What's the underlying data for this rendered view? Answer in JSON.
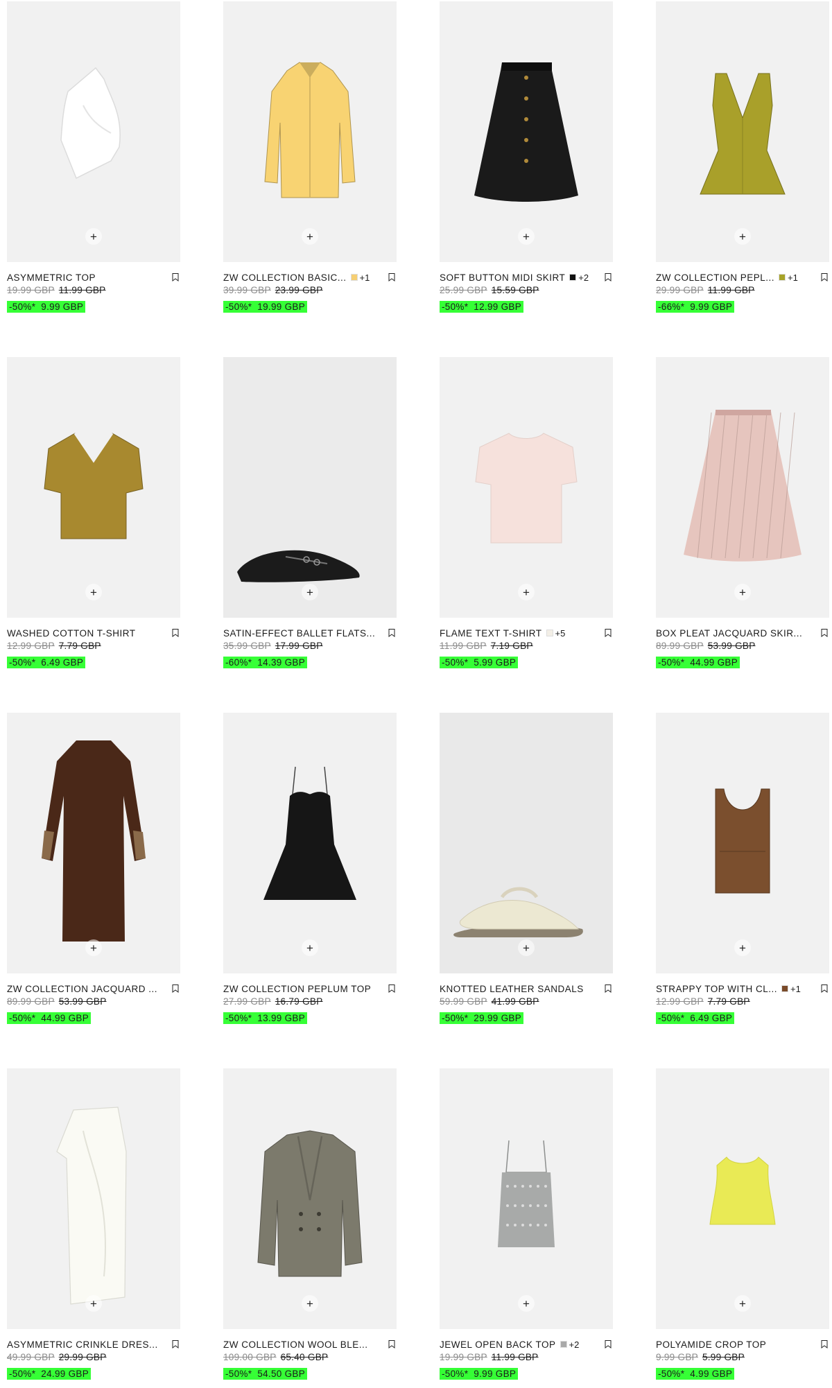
{
  "products": [
    {
      "name": "ASYMMETRIC TOP",
      "swatches": [],
      "more": "",
      "original": "19.99 GBP",
      "previous": "11.99 GBP",
      "discount": "-50%*",
      "price": "9.99 GBP",
      "bg": "#f1f1f1",
      "garment": "asym-top",
      "color": "#ffffff"
    },
    {
      "name": "ZW COLLECTION BASIC...",
      "swatches": [
        "#f6cf73"
      ],
      "more": "+1",
      "original": "39.99 GBP",
      "previous": "23.99 GBP",
      "discount": "-50%*",
      "price": "19.99 GBP",
      "bg": "#f1f1f1",
      "garment": "shirt",
      "color": "#f8d372"
    },
    {
      "name": "SOFT BUTTON MIDI SKIRT",
      "swatches": [
        "#111111"
      ],
      "more": "+2",
      "original": "25.99 GBP",
      "previous": "15.59 GBP",
      "discount": "-50%*",
      "price": "12.99 GBP",
      "bg": "#f1f1f1",
      "garment": "midi-skirt",
      "color": "#1a1a1a"
    },
    {
      "name": "ZW COLLECTION PEPL...",
      "swatches": [
        "#a7a328"
      ],
      "more": "+1",
      "original": "29.99 GBP",
      "previous": "11.99 GBP",
      "discount": "-66%*",
      "price": "9.99 GBP",
      "bg": "#f1f1f1",
      "garment": "peplum-vtop",
      "color": "#a9a02a"
    },
    {
      "name": "WASHED COTTON T-SHIRT",
      "swatches": [],
      "more": "",
      "original": "12.99 GBP",
      "previous": "7.79 GBP",
      "discount": "-50%*",
      "price": "6.49 GBP",
      "bg": "#f1f1f1",
      "garment": "vtee",
      "color": "#a8892f"
    },
    {
      "name": "SATIN-EFFECT BALLET FLATS...",
      "swatches": [],
      "more": "",
      "original": "35.99 GBP",
      "previous": "17.99 GBP",
      "discount": "-60%*",
      "price": "14.39 GBP",
      "bg": "#ebebeb",
      "garment": "flat",
      "color": "#1b1b1b"
    },
    {
      "name": "FLAME TEXT T-SHIRT",
      "swatches": [
        "#f3efe7"
      ],
      "more": "+5",
      "original": "11.99 GBP",
      "previous": "7.19 GBP",
      "discount": "-50%*",
      "price": "5.99 GBP",
      "bg": "#f1f1f1",
      "garment": "tee",
      "color": "#f6e1dc"
    },
    {
      "name": "BOX PLEAT JACQUARD SKIR...",
      "swatches": [],
      "more": "",
      "original": "89.99 GBP",
      "previous": "53.99 GBP",
      "discount": "-50%*",
      "price": "44.99 GBP",
      "bg": "#f1f1f1",
      "garment": "pleat-skirt",
      "color": "#e6c5be"
    },
    {
      "name": "ZW COLLECTION JACQUARD ...",
      "swatches": [],
      "more": "",
      "original": "89.99 GBP",
      "previous": "53.99 GBP",
      "discount": "-50%*",
      "price": "44.99 GBP",
      "bg": "#f1f1f1",
      "garment": "long-dress",
      "color": "#4a2818"
    },
    {
      "name": "ZW COLLECTION PEPLUM TOP",
      "swatches": [],
      "more": "",
      "original": "27.99 GBP",
      "previous": "16.79 GBP",
      "discount": "-50%*",
      "price": "13.99 GBP",
      "bg": "#f1f1f1",
      "garment": "cami-peplum",
      "color": "#161616"
    },
    {
      "name": "KNOTTED LEATHER SANDALS",
      "swatches": [],
      "more": "",
      "original": "59.99 GBP",
      "previous": "41.99 GBP",
      "discount": "-50%*",
      "price": "29.99 GBP",
      "bg": "#e9e9e9",
      "garment": "sandal",
      "color": "#ece8d2"
    },
    {
      "name": "STRAPPY TOP WITH CL...",
      "swatches": [
        "#7a4b2a"
      ],
      "more": "+1",
      "original": "12.99 GBP",
      "previous": "7.79 GBP",
      "discount": "-50%*",
      "price": "6.49 GBP",
      "bg": "#f1f1f1",
      "garment": "tank",
      "color": "#7b4f2e"
    },
    {
      "name": "ASYMMETRIC CRINKLE DRES...",
      "swatches": [],
      "more": "",
      "original": "49.99 GBP",
      "previous": "29.99 GBP",
      "discount": "-50%*",
      "price": "24.99 GBP",
      "bg": "#f1f1f1",
      "garment": "asym-dress",
      "color": "#fafaf4"
    },
    {
      "name": "ZW COLLECTION WOOL BLE...",
      "swatches": [],
      "more": "",
      "original": "109.00 GBP",
      "previous": "65.40 GBP",
      "discount": "-50%*",
      "price": "54.50 GBP",
      "bg": "#f1f1f1",
      "garment": "blazer",
      "color": "#7c7a6c"
    },
    {
      "name": "JEWEL OPEN BACK TOP",
      "swatches": [
        "#a9a9a9"
      ],
      "more": "+2",
      "original": "19.99 GBP",
      "previous": "11.99 GBP",
      "discount": "-50%*",
      "price": "9.99 GBP",
      "bg": "#f1f1f1",
      "garment": "cami",
      "color": "#a8aaa9"
    },
    {
      "name": "POLYAMIDE CROP TOP",
      "swatches": [],
      "more": "",
      "original": "9.99 GBP",
      "previous": "5.99 GBP",
      "discount": "-50%*",
      "price": "4.99 GBP",
      "bg": "#f1f1f1",
      "garment": "crop",
      "color": "#e9ea55"
    }
  ],
  "add_symbol": "+"
}
